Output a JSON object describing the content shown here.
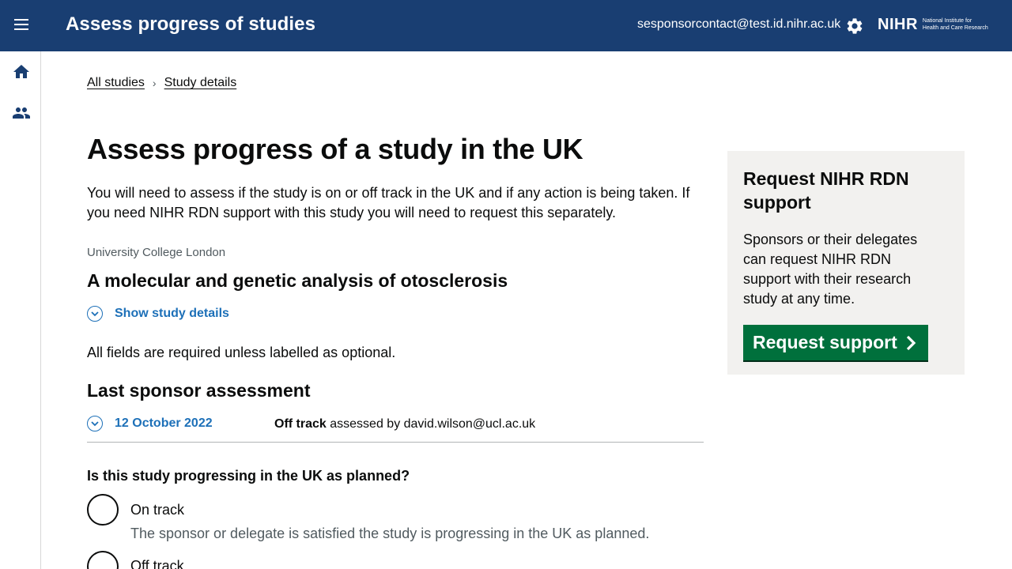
{
  "header": {
    "app_title": "Assess progress of studies",
    "user_email": "sesponsorcontact@test.id.nihr.ac.uk",
    "logo_text": "NIHR",
    "logo_subtext_line1": "National Institute for",
    "logo_subtext_line2": "Health and Care Research",
    "background_color": "#193e72"
  },
  "sidenav": {
    "items": [
      {
        "icon": "home-icon"
      },
      {
        "icon": "people-icon"
      }
    ]
  },
  "breadcrumb": {
    "items": [
      "All studies",
      "Study details"
    ]
  },
  "main": {
    "title": "Assess progress of a study in the UK",
    "intro": "You will need to assess if the study is on or off track in the UK and if any action is being taken. If you need NIHR RDN support with this study you will need to request this separately.",
    "organisation": "University College London",
    "study_title": "A molecular and genetic analysis of otosclerosis",
    "show_details_label": "Show study details",
    "required_note": "All fields are required unless labelled as optional.",
    "last_assessment_heading": "Last sponsor assessment",
    "last_assessment": {
      "date": "12 October 2022",
      "status": "Off track",
      "assessed_by_text": "assessed by david.wilson@ucl.ac.uk"
    },
    "question": "Is this study progressing in the UK as planned?",
    "options": [
      {
        "label": "On track",
        "hint": "The sponsor or delegate is satisfied the study is progressing in the UK as planned."
      },
      {
        "label": "Off track"
      }
    ]
  },
  "side_panel": {
    "title": "Request NIHR RDN support",
    "text": "Sponsors or their delegates can request NIHR RDN support with their research study at any time.",
    "button_label": "Request support",
    "button_color": "#00703c"
  }
}
